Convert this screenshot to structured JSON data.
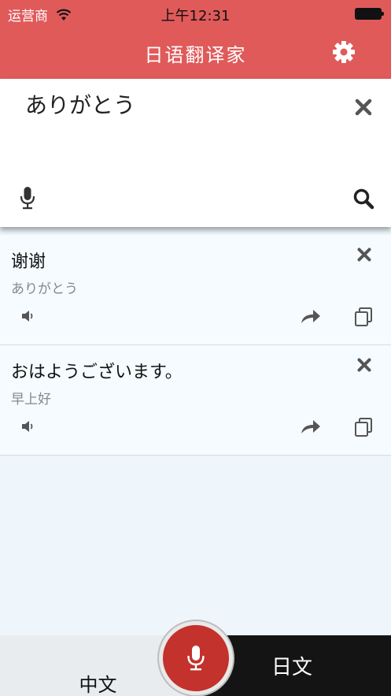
{
  "status": {
    "carrier": "运营商",
    "time": "上午12:31"
  },
  "header": {
    "title": "日语翻译家"
  },
  "input": {
    "text": "ありがとう"
  },
  "history": [
    {
      "main": "谢谢",
      "sub": "ありがとう"
    },
    {
      "main": "おはようございます。",
      "sub": "早上好"
    }
  ],
  "bottom": {
    "left_lang": "中文",
    "right_lang": "日文"
  },
  "colors": {
    "header": "#e05a5a",
    "mic": "#c3322c",
    "icon": "#555555"
  },
  "icons": [
    "wifi-icon",
    "battery-icon",
    "gear-icon",
    "close-icon",
    "mic-icon",
    "search-icon",
    "speaker-icon",
    "share-icon",
    "copy-icon"
  ]
}
